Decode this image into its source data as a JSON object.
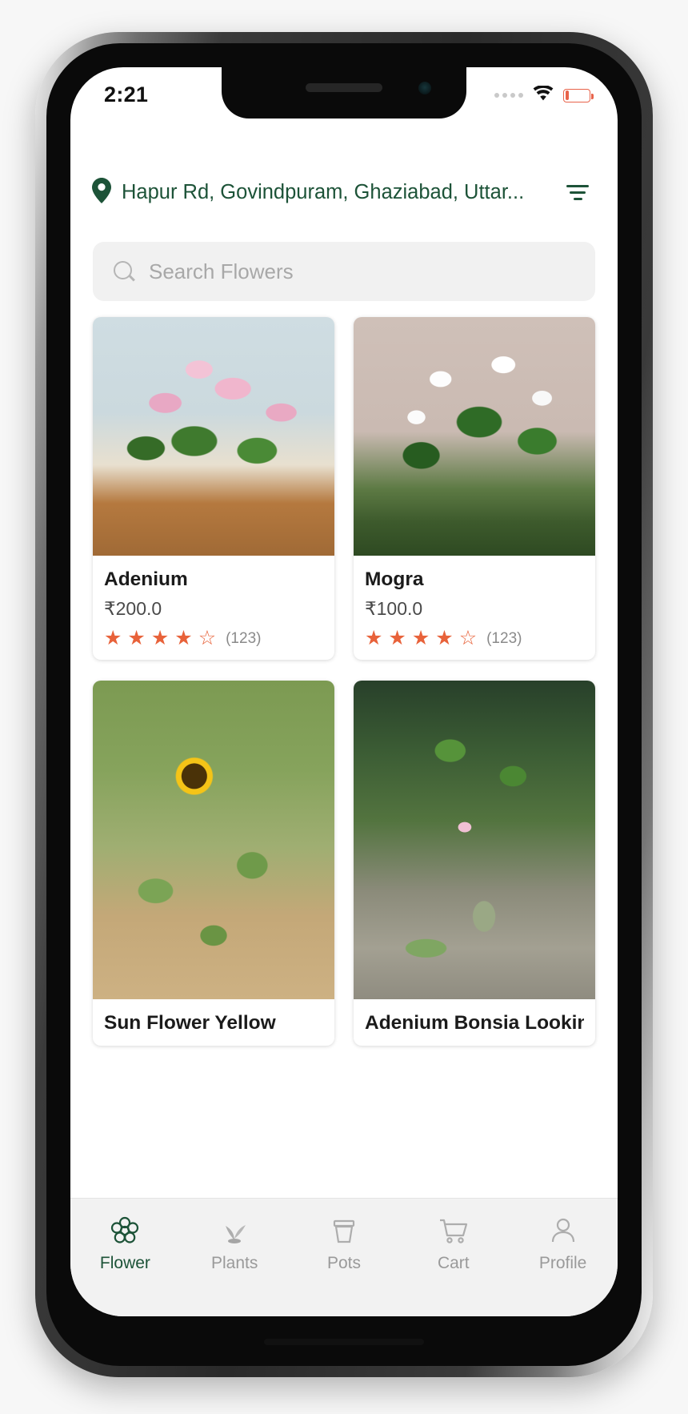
{
  "status_bar": {
    "time": "2:21",
    "signal_dots": 4,
    "wifi_icon": "wifi-icon",
    "battery_icon": "battery-low-icon",
    "battery_level_pct": 14,
    "battery_color": "#e8634a"
  },
  "app_bar": {
    "location_icon": "map-pin-icon",
    "location_text": "Hapur Rd, Govindpuram, Ghaziabad, Uttar...",
    "filter_icon": "filter-icon",
    "accent_color": "#1d5338"
  },
  "search": {
    "icon": "search-icon",
    "placeholder": "Search Flowers",
    "value": ""
  },
  "products": [
    {
      "name": "Adenium",
      "price": "₹200.0",
      "stars_filled": 4,
      "stars_total": 5,
      "review_count": "(123)",
      "photo": "adenium-pink-flower-plant-photo"
    },
    {
      "name": "Mogra",
      "price": "₹100.0",
      "stars_filled": 4,
      "stars_total": 5,
      "review_count": "(123)",
      "photo": "mogra-white-jasmine-plant-photo"
    },
    {
      "name": "Sun Flower Yellow",
      "price": "",
      "stars_filled": 0,
      "stars_total": 5,
      "review_count": "",
      "photo": "sunflower-yellow-garden-photo"
    },
    {
      "name": "Adenium Bonsia Looking",
      "price": "",
      "stars_filled": 0,
      "stars_total": 5,
      "review_count": "",
      "photo": "adenium-bonsai-caudex-plant-photo"
    }
  ],
  "star_glyphs": {
    "filled": "★",
    "empty": "☆",
    "color": "#e8623a"
  },
  "bottom_nav": {
    "active_index": 0,
    "items": [
      {
        "label": "Flower",
        "icon": "flower-icon"
      },
      {
        "label": "Plants",
        "icon": "seedling-icon"
      },
      {
        "label": "Pots",
        "icon": "flower-pot-icon"
      },
      {
        "label": "Cart",
        "icon": "shopping-cart-icon"
      },
      {
        "label": "Profile",
        "icon": "user-person-icon"
      }
    ]
  }
}
